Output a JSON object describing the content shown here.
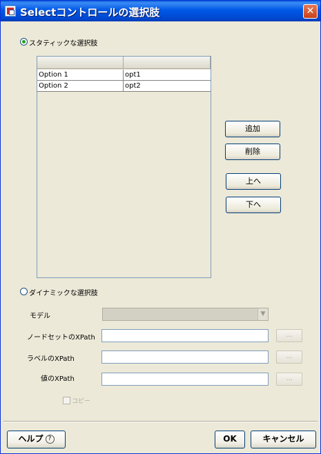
{
  "window": {
    "title": "Selectコントロールの選択肢",
    "close_glyph": "✕"
  },
  "static_option": {
    "label": "スタティックな選択肢",
    "selected": true
  },
  "dynamic_option": {
    "label": "ダイナミックな選択肢",
    "selected": false
  },
  "options_table": {
    "columns": [
      "",
      ""
    ],
    "rows": [
      {
        "label": "Option 1",
        "value": "opt1"
      },
      {
        "label": "Option 2",
        "value": "opt2"
      }
    ]
  },
  "side_buttons": {
    "add": "追加",
    "delete": "削除",
    "up": "上へ",
    "down": "下へ"
  },
  "dynamic": {
    "model_label": "モデル",
    "model_value": "",
    "nodeset_label": "ノードセットのXPath",
    "nodeset_value": "",
    "label_xpath_label": "ラベルのXPath",
    "label_xpath_value": "",
    "value_xpath_label": "値のXPath",
    "value_xpath_value": "",
    "browse_label": "...",
    "copy_label": "コピー"
  },
  "footer": {
    "help": "ヘルプ",
    "help_icon": "?",
    "ok": "OK",
    "cancel": "キャンセル"
  },
  "colors": {
    "titlebar": "#0058e6",
    "dialog_bg": "#ece9d8",
    "radio_dot": "#21a121",
    "close_btn": "#c8421a"
  }
}
